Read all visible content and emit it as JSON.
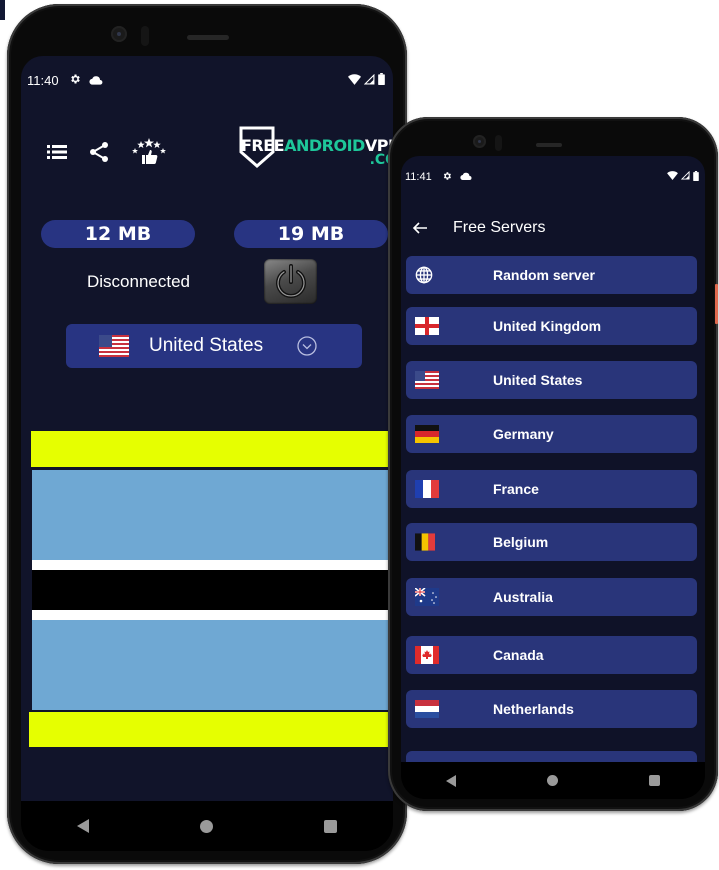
{
  "left_phone": {
    "status_bar": {
      "time": "11:40",
      "icons": [
        "gear-icon",
        "cloud-icon"
      ],
      "right_icons": [
        "wifi-icon",
        "signal-icon",
        "battery-icon"
      ]
    },
    "toolbar": {
      "icons": [
        "menu-list-icon",
        "share-icon",
        "rate-stars-thumb-icon"
      ]
    },
    "logo": {
      "part1": "FREE",
      "part2": "ANDROID",
      "part3": "VPN",
      "suffix": ".COM"
    },
    "traffic": {
      "download": "12 MB",
      "upload": "19 MB"
    },
    "connection_status": "Disconnected",
    "selected_country": {
      "flag": "us-flag",
      "name": "United States"
    },
    "banner_flag": {
      "country": "Botswana",
      "colors": {
        "yellow": "#e6ff00",
        "blue": "#6fa8d3",
        "white": "#ffffff",
        "black": "#000000"
      }
    },
    "nav": [
      "back",
      "home",
      "recents"
    ]
  },
  "right_phone": {
    "status_bar": {
      "time": "11:41",
      "icons": [
        "gear-icon",
        "cloud-icon"
      ],
      "right_icons": [
        "wifi-icon",
        "signal-icon",
        "battery-icon"
      ]
    },
    "header": {
      "title": "Free Servers"
    },
    "servers": [
      {
        "icon": "globe-icon",
        "name": "Random server"
      },
      {
        "icon": "uk-flag",
        "name": "United Kingdom"
      },
      {
        "icon": "us-flag",
        "name": "United States"
      },
      {
        "icon": "de-flag",
        "name": "Germany"
      },
      {
        "icon": "fr-flag",
        "name": "France"
      },
      {
        "icon": "be-flag",
        "name": "Belgium"
      },
      {
        "icon": "au-flag",
        "name": "Australia"
      },
      {
        "icon": "ca-flag",
        "name": "Canada"
      },
      {
        "icon": "nl-flag",
        "name": "Netherlands"
      }
    ],
    "nav": [
      "back",
      "home",
      "recents"
    ]
  },
  "colors": {
    "screen_bg": "#11142a",
    "card": "#29357a",
    "pill": "#283482",
    "accent_green": "#1ec79a"
  }
}
